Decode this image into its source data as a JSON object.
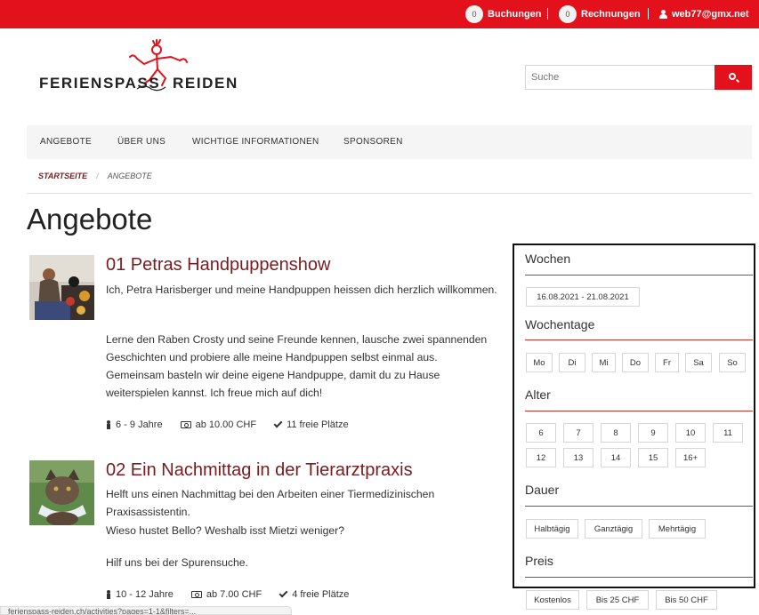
{
  "topbar": {
    "bookings_count": "0",
    "bookings_label": "Buchungen",
    "invoices_count": "0",
    "invoices_label": "Rechnungen",
    "user_email": "web77@gmx.net"
  },
  "logo": {
    "word1": "FERIENSPASS",
    "word2": "REIDEN"
  },
  "search": {
    "placeholder": "Suche"
  },
  "nav": {
    "items": [
      "ANGEBOTE",
      "ÜBER UNS",
      "WICHTIGE INFORMATIONEN",
      "SPONSOREN"
    ]
  },
  "breadcrumb": {
    "home": "STARTSEITE",
    "separator": "/",
    "current": "ANGEBOTE"
  },
  "page_title": "Angebote",
  "offers": [
    {
      "title": "01 Petras Handpuppenshow",
      "desc1": "Ich, Petra Harisberger und meine Handpuppen heissen dich herzlich willkommen.",
      "desc2": "Lerne den Raben Crosty und seine Freunde kennen, lausche zwei spannenden Geschichten und probiere alle meine Handpuppen selbst einmal aus. Gemeinsam basteln wir deine eigene Handpuppe, damit du zu Hause weiterspielen kannst. Ich freue mich auf dich!",
      "age": "6 - 9 Jahre",
      "price": "ab 10.00 CHF",
      "spots": "11 freie Plätze"
    },
    {
      "title": "02 Ein Nachmittag in der Tierarztpraxis",
      "desc1": "Helft uns einen Nachmittag bei den Arbeiten einer Tiermedizinischen Praxisassistentin.",
      "desc1b": "Wieso hustet Bello? Weshalb isst Mietzi weniger?",
      "desc2": "Hilf uns bei der Spurensuche.",
      "age": "10 - 12 Jahre",
      "price": "ab 7.00 CHF",
      "spots": "4 freie Plätze"
    }
  ],
  "filters": {
    "weeks_title": "Wochen",
    "weeks": [
      "16.08.2021 - 21.08.2021"
    ],
    "weekdays_title": "Wochentage",
    "weekdays": [
      "Mo",
      "Di",
      "Mi",
      "Do",
      "Fr",
      "Sa",
      "So"
    ],
    "age_title": "Alter",
    "ages": [
      "6",
      "7",
      "8",
      "9",
      "10",
      "11",
      "12",
      "13",
      "14",
      "15",
      "16+"
    ],
    "duration_title": "Dauer",
    "durations": [
      "Halbtägig",
      "Ganztägig",
      "Mehrtägig"
    ],
    "price_title": "Preis",
    "prices": [
      "Kostenlos",
      "Bis 25 CHF",
      "Bis 50 CHF"
    ]
  },
  "statusbar": {
    "url": "ferienspass-reiden.ch/activities?pages=1-1&filters=..."
  },
  "colors": {
    "brand_red": "#e3111b",
    "title_maroon": "#7a1b1f"
  }
}
